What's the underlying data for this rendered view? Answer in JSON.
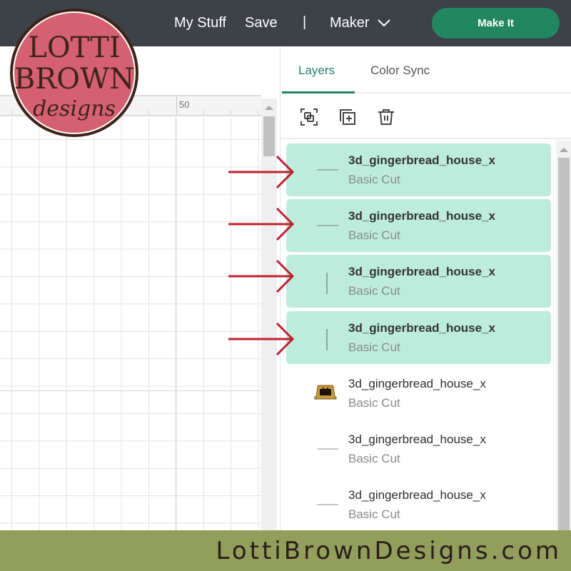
{
  "topbar": {
    "my_stuff": "My Stuff",
    "save": "Save",
    "separator": "|",
    "machine": "Maker",
    "make_it": "Make It"
  },
  "canvas": {
    "ruler_label": "50"
  },
  "panel": {
    "tabs": [
      {
        "label": "Layers",
        "active": true
      },
      {
        "label": "Color Sync",
        "active": false
      }
    ],
    "toolbar": [
      {
        "icon": "group-icon"
      },
      {
        "icon": "duplicate-icon"
      },
      {
        "icon": "delete-icon"
      }
    ],
    "layers": [
      {
        "name": "3d_gingerbread_house_x",
        "operation": "Basic Cut",
        "selected": true,
        "thumbnail": "horizontal-line"
      },
      {
        "name": "3d_gingerbread_house_x",
        "operation": "Basic Cut",
        "selected": true,
        "thumbnail": "horizontal-line"
      },
      {
        "name": "3d_gingerbread_house_x",
        "operation": "Basic Cut",
        "selected": true,
        "thumbnail": "vertical-line"
      },
      {
        "name": "3d_gingerbread_house_x",
        "operation": "Basic Cut",
        "selected": true,
        "thumbnail": "vertical-line"
      },
      {
        "name": "3d_gingerbread_house_x",
        "operation": "Basic Cut",
        "selected": false,
        "thumbnail": "house-piece"
      },
      {
        "name": "3d_gingerbread_house_x",
        "operation": "Basic Cut",
        "selected": false,
        "thumbnail": "horizontal-line"
      },
      {
        "name": "3d_gingerbread_house_x",
        "operation": "Basic Cut",
        "selected": false,
        "thumbnail": "horizontal-line"
      }
    ]
  },
  "logo": {
    "line1": "LOTTI",
    "line2": "BROWN",
    "line3": "designs"
  },
  "footer": {
    "website": "LottiBrownDesigns.com"
  },
  "colors": {
    "topbar": "#3d4249",
    "accent_green": "#228660",
    "selected_layer": "#bdecdc",
    "annotation_arrow": "#c0202e",
    "logo_fill": "#d46070",
    "logo_ink": "#3d2418",
    "footer": "#929e5c"
  }
}
